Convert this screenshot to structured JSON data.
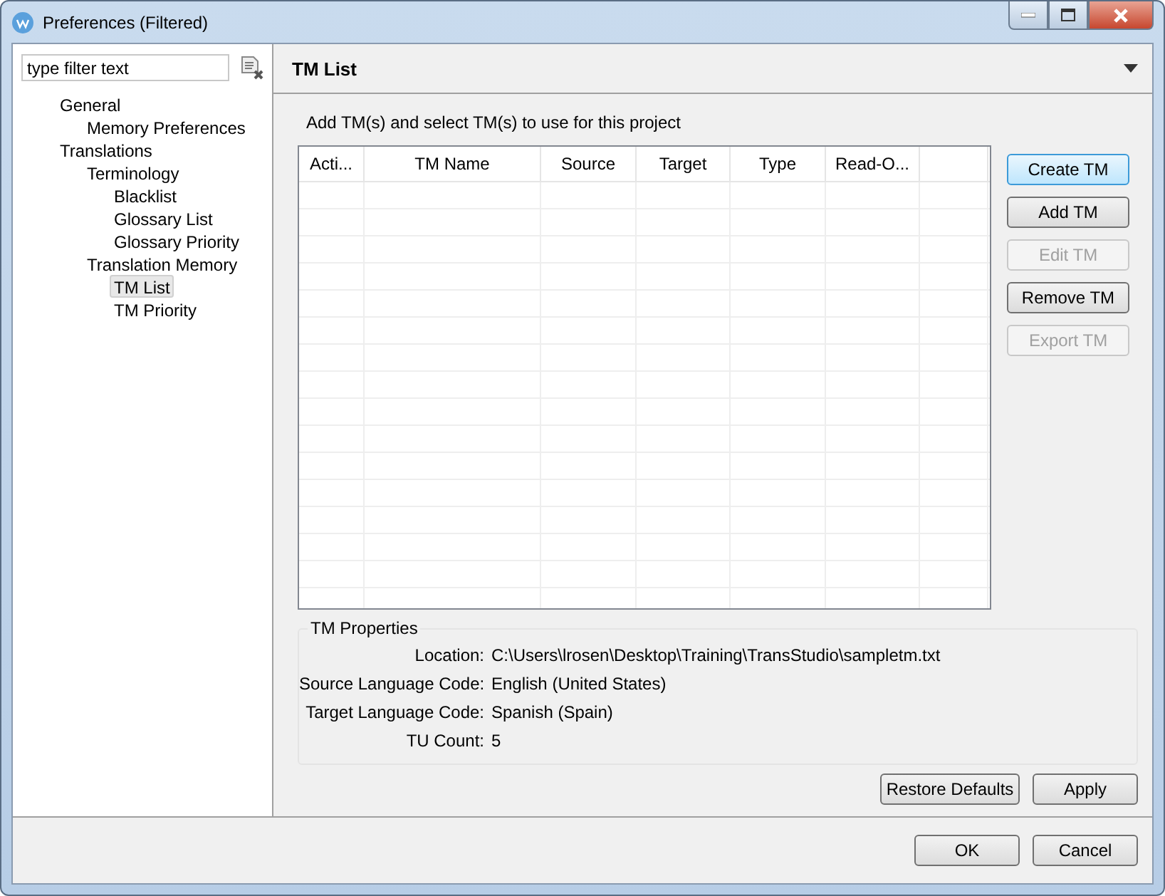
{
  "window": {
    "title": "Preferences (Filtered)"
  },
  "filter": {
    "placeholder": "type filter text"
  },
  "tree": [
    {
      "label": "General",
      "selected": false,
      "children": [
        {
          "label": "Memory Preferences",
          "selected": false
        }
      ]
    },
    {
      "label": "Translations",
      "selected": false,
      "children": [
        {
          "label": "Terminology",
          "selected": false,
          "children": [
            {
              "label": "Blacklist",
              "selected": false
            },
            {
              "label": "Glossary List",
              "selected": false
            },
            {
              "label": "Glossary Priority",
              "selected": false
            }
          ]
        },
        {
          "label": "Translation Memory",
          "selected": false,
          "children": [
            {
              "label": "TM List",
              "selected": true
            },
            {
              "label": "TM Priority",
              "selected": false
            }
          ]
        }
      ]
    }
  ],
  "page": {
    "title": "TM List",
    "description": "Add TM(s) and select TM(s) to use for this project"
  },
  "table": {
    "columns": [
      "Acti...",
      "TM Name",
      "Source",
      "Target",
      "Type",
      "Read-O..."
    ]
  },
  "side_buttons": [
    {
      "label": "Create TM",
      "disabled": false,
      "focused": true
    },
    {
      "label": "Add TM",
      "disabled": false,
      "focused": false
    },
    {
      "label": "Edit TM",
      "disabled": true,
      "focused": false
    },
    {
      "label": "Remove TM",
      "disabled": false,
      "focused": false
    },
    {
      "label": "Export TM",
      "disabled": true,
      "focused": false
    }
  ],
  "properties": {
    "title": "TM Properties",
    "fields": [
      {
        "label": "Location:",
        "value": "C:\\Users\\lrosen\\Desktop\\Training\\TransStudio\\sampletm.txt"
      },
      {
        "label": "Source Language Code:",
        "value": "English (United States)"
      },
      {
        "label": "Target Language Code:",
        "value": "Spanish (Spain)"
      },
      {
        "label": "TU Count:",
        "value": "5"
      }
    ]
  },
  "page_buttons": [
    "Restore Defaults",
    "Apply"
  ],
  "dialog_buttons": [
    "OK",
    "Cancel"
  ]
}
